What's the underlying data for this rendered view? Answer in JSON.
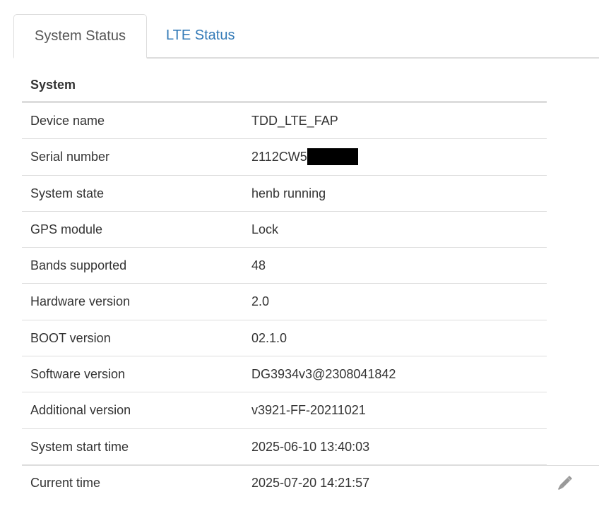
{
  "tabs": [
    {
      "label": "System Status",
      "active": true
    },
    {
      "label": "LTE Status",
      "active": false
    }
  ],
  "system": {
    "heading": "System",
    "rows": [
      {
        "label": "Device name",
        "value": "TDD_LTE_FAP"
      },
      {
        "label": "Serial number",
        "value": "2112CW5",
        "redacted_suffix": true
      },
      {
        "label": "System state",
        "value": "henb running"
      },
      {
        "label": "GPS module",
        "value": "Lock"
      },
      {
        "label": "Bands supported",
        "value": "48"
      },
      {
        "label": "Hardware version",
        "value": "2.0"
      },
      {
        "label": "BOOT version",
        "value": "02.1.0"
      },
      {
        "label": "Software version",
        "value": "DG3934v3@2308041842"
      },
      {
        "label": "Additional version",
        "value": "v3921-FF-20211021"
      },
      {
        "label": "System start time",
        "value": "2025-06-10 13:40:03"
      },
      {
        "label": "Current time",
        "value": "2025-07-20 14:21:57",
        "edit_icon": "pencil-icon"
      }
    ]
  },
  "colors": {
    "link": "#337ab7",
    "text": "#333333",
    "border": "#dddddd",
    "icon": "#999999"
  }
}
